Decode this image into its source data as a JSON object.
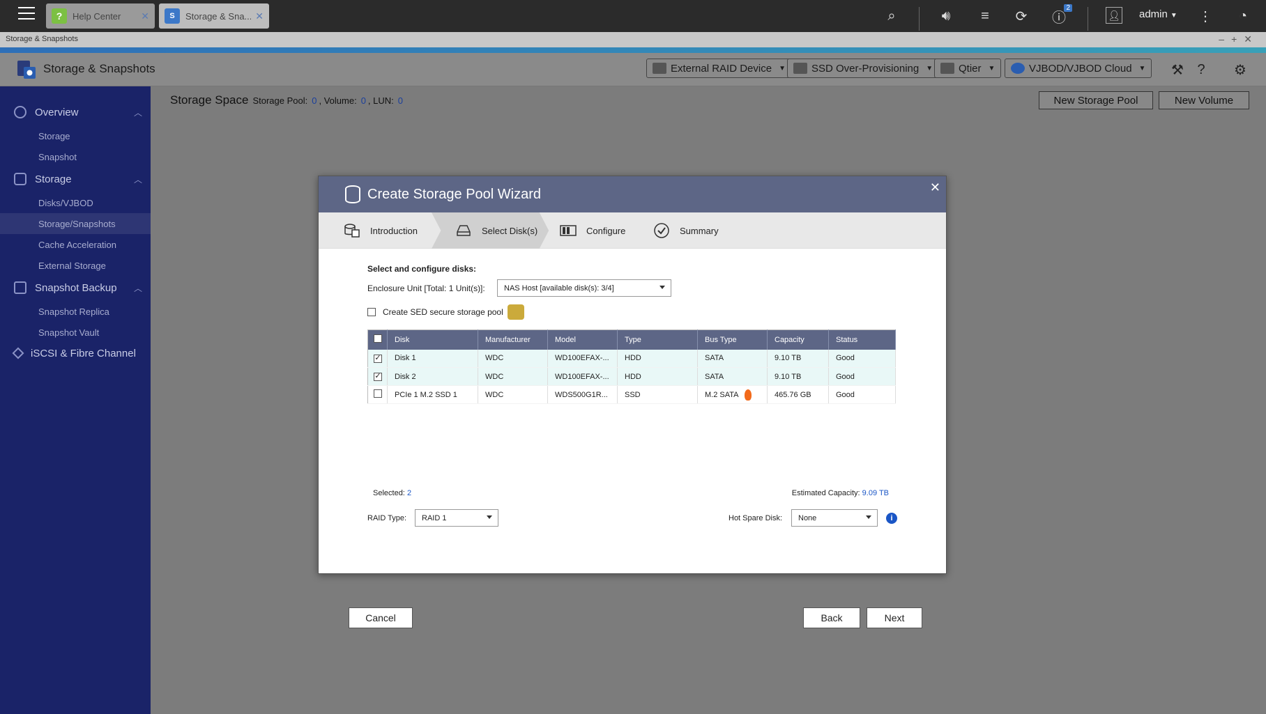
{
  "taskbar": {
    "tabs": [
      {
        "label": "Help Center",
        "icon": "?"
      },
      {
        "label": "Storage & Sna...",
        "icon": "S"
      }
    ],
    "notification_count": "2",
    "user": "admin"
  },
  "app": {
    "window_title": "Storage & Snapshots",
    "title": "Storage & Snapshots",
    "header_buttons": [
      "External RAID Device",
      "SSD Over-Provisioning",
      "Qtier",
      "VJBOD/VJBOD Cloud"
    ]
  },
  "sidebar": {
    "groups": [
      {
        "label": "Overview",
        "items": [
          "Storage",
          "Snapshot"
        ]
      },
      {
        "label": "Storage",
        "items": [
          "Disks/VJBOD",
          "Storage/Snapshots",
          "Cache Acceleration",
          "External Storage"
        ]
      },
      {
        "label": "Snapshot Backup",
        "items": [
          "Snapshot Replica",
          "Snapshot Vault"
        ]
      },
      {
        "label": "iSCSI & Fibre Channel",
        "items": []
      }
    ]
  },
  "main": {
    "title": "Storage Space",
    "pool_label": "Storage Pool:",
    "pool_count": "0",
    "volume_label": ", Volume:",
    "volume_count": "0",
    "lun_label": ", LUN:",
    "lun_count": "0",
    "new_pool_button": "New Storage Pool",
    "new_volume_button": "New Volume"
  },
  "wizard": {
    "title": "Create Storage Pool Wizard",
    "steps": [
      "Introduction",
      "Select Disk(s)",
      "Configure",
      "Summary"
    ],
    "active_step": 1,
    "select_label": "Select and configure disks:",
    "enclosure_label": "Enclosure Unit [Total: 1 Unit(s)]:",
    "enclosure_value": "NAS Host [available disk(s): 3/4]",
    "sed_label": "Create SED secure storage pool",
    "columns": [
      "Disk",
      "Manufacturer",
      "Model",
      "Type",
      "Bus Type",
      "Capacity",
      "Status"
    ],
    "disks": [
      {
        "checked": true,
        "disk": "Disk 1",
        "manufacturer": "WDC",
        "model": "WD100EFAX-...",
        "type": "HDD",
        "bus": "SATA",
        "capacity": "9.10 TB",
        "status": "Good"
      },
      {
        "checked": true,
        "disk": "Disk 2",
        "manufacturer": "WDC",
        "model": "WD100EFAX-...",
        "type": "HDD",
        "bus": "SATA",
        "capacity": "9.10 TB",
        "status": "Good"
      },
      {
        "checked": false,
        "disk": "PCIe 1 M.2 SSD 1",
        "manufacturer": "WDC",
        "model": "WDS500G1R...",
        "type": "SSD",
        "bus": "M.2 SATA",
        "capacity": "465.76 GB",
        "status": "Good"
      }
    ],
    "selected_label": "Selected:",
    "selected_count": "2",
    "estimated_label": "Estimated Capacity:",
    "estimated_value": "9.09 TB",
    "raid_label": "RAID Type:",
    "raid_value": "RAID 1",
    "hot_spare_label": "Hot Spare Disk:",
    "hot_spare_value": "None",
    "cancel": "Cancel",
    "back": "Back",
    "next": "Next"
  }
}
